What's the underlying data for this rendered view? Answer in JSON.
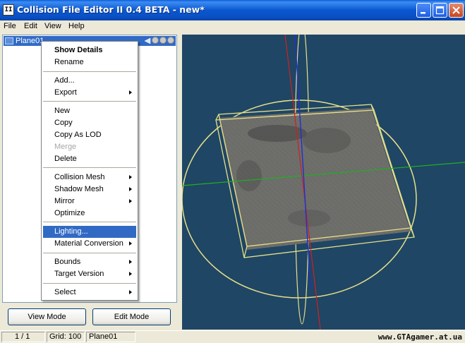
{
  "window": {
    "title": "Collision File Editor II 0.4 BETA - new*",
    "icon_text": "II"
  },
  "menubar": {
    "items": [
      "File",
      "Edit",
      "View",
      "Help"
    ]
  },
  "tree": {
    "selected_item": "Plane01"
  },
  "context_menu": {
    "items": [
      {
        "label": "Show Details",
        "bold": true
      },
      {
        "label": "Rename"
      },
      {
        "label": "Add..."
      },
      {
        "label": "Export",
        "submenu": true
      },
      {
        "label": "New"
      },
      {
        "label": "Copy"
      },
      {
        "label": "Copy As LOD"
      },
      {
        "label": "Merge",
        "disabled": true
      },
      {
        "label": "Delete"
      },
      {
        "label": "Collision Mesh",
        "submenu": true
      },
      {
        "label": "Shadow Mesh",
        "submenu": true
      },
      {
        "label": "Mirror",
        "submenu": true
      },
      {
        "label": "Optimize"
      },
      {
        "label": "Lighting...",
        "highlighted": true
      },
      {
        "label": "Material Conversion",
        "submenu": true
      },
      {
        "label": "Bounds",
        "submenu": true
      },
      {
        "label": "Target Version",
        "submenu": true
      },
      {
        "label": "Select",
        "submenu": true
      }
    ]
  },
  "buttons": {
    "view_mode": "View Mode",
    "edit_mode": "Edit Mode"
  },
  "statusbar": {
    "count": "1 / 1",
    "grid": "Grid: 100",
    "object": "Plane01"
  },
  "watermark": "www.GTAgamer.at.ua",
  "colors": {
    "titlebar": "#0a58d0",
    "selection": "#316ac5",
    "viewport_bg": "#1f4664",
    "bounds_lines": "#e7e08a",
    "axis_x": "#d02020",
    "axis_y": "#20b020",
    "axis_z": "#2030d0",
    "mesh_fill": "#6b6b68"
  }
}
